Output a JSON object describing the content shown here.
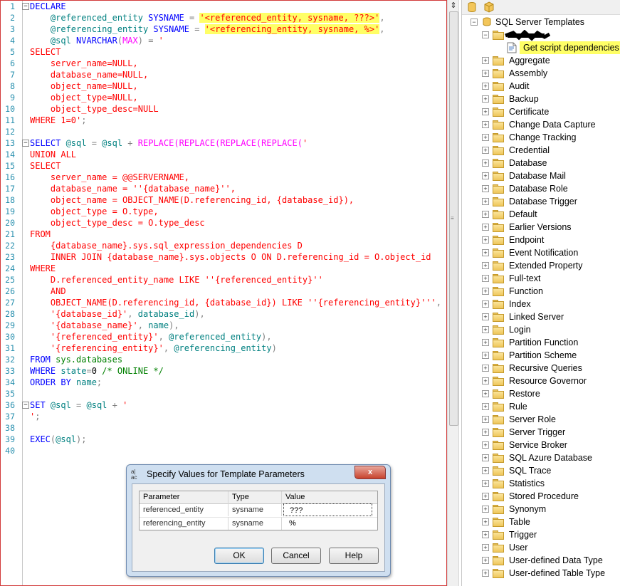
{
  "editor": {
    "lines": [
      {
        "num": "1",
        "fold": "−",
        "segs": [
          {
            "t": "DECLARE",
            "c": "k"
          }
        ]
      },
      {
        "num": "2",
        "segs": [
          {
            "t": "    @referenced_entity ",
            "c": "c"
          },
          {
            "t": "SYSNAME",
            "c": "k"
          },
          {
            "t": " = ",
            "c": "g"
          },
          {
            "t": "'<referenced_entity, sysname, ???>'",
            "c": "r",
            "hl": true
          },
          {
            "t": ",",
            "c": "g"
          }
        ]
      },
      {
        "num": "3",
        "segs": [
          {
            "t": "    @referencing_entity ",
            "c": "c"
          },
          {
            "t": "SYSNAME",
            "c": "k"
          },
          {
            "t": " = ",
            "c": "g"
          },
          {
            "t": "'<referencing_entity, sysname, %>'",
            "c": "r",
            "hl": true
          },
          {
            "t": ",",
            "c": "g"
          }
        ]
      },
      {
        "num": "4",
        "segs": [
          {
            "t": "    @sql ",
            "c": "c"
          },
          {
            "t": "NVARCHAR",
            "c": "k"
          },
          {
            "t": "(",
            "c": "g"
          },
          {
            "t": "MAX",
            "c": "m"
          },
          {
            "t": ") = ",
            "c": "g"
          },
          {
            "t": "'",
            "c": "r"
          }
        ]
      },
      {
        "num": "5",
        "segs": [
          {
            "t": "SELECT",
            "c": "r"
          }
        ]
      },
      {
        "num": "6",
        "segs": [
          {
            "t": "    server_name=NULL,",
            "c": "r"
          }
        ]
      },
      {
        "num": "7",
        "segs": [
          {
            "t": "    database_name=NULL,",
            "c": "r"
          }
        ]
      },
      {
        "num": "8",
        "segs": [
          {
            "t": "    object_name=NULL,",
            "c": "r"
          }
        ]
      },
      {
        "num": "9",
        "segs": [
          {
            "t": "    object_type=NULL,",
            "c": "r"
          }
        ]
      },
      {
        "num": "10",
        "segs": [
          {
            "t": "    object_type_desc=NULL",
            "c": "r"
          }
        ]
      },
      {
        "num": "11",
        "segs": [
          {
            "t": "WHERE 1=0'",
            "c": "r"
          },
          {
            "t": ";",
            "c": "g"
          }
        ]
      },
      {
        "num": "12",
        "segs": []
      },
      {
        "num": "13",
        "fold": "−",
        "segs": [
          {
            "t": "SELECT",
            "c": "k"
          },
          {
            "t": " @sql ",
            "c": "c"
          },
          {
            "t": "= ",
            "c": "g"
          },
          {
            "t": "@sql",
            "c": "c"
          },
          {
            "t": " + ",
            "c": "g"
          },
          {
            "t": "REPLACE(REPLACE(REPLACE(REPLACE(",
            "c": "m"
          },
          {
            "t": "'",
            "c": "r"
          }
        ]
      },
      {
        "num": "14",
        "segs": [
          {
            "t": "UNION ALL",
            "c": "r"
          }
        ]
      },
      {
        "num": "15",
        "segs": [
          {
            "t": "SELECT",
            "c": "r"
          }
        ]
      },
      {
        "num": "16",
        "segs": [
          {
            "t": "    server_name = @@SERVERNAME,",
            "c": "r"
          }
        ]
      },
      {
        "num": "17",
        "segs": [
          {
            "t": "    database_name = ''{database_name}'',",
            "c": "r"
          }
        ]
      },
      {
        "num": "18",
        "segs": [
          {
            "t": "    object_name = OBJECT_NAME(D.referencing_id, {database_id}),",
            "c": "r"
          }
        ]
      },
      {
        "num": "19",
        "segs": [
          {
            "t": "    object_type = O.type,",
            "c": "r"
          }
        ]
      },
      {
        "num": "20",
        "segs": [
          {
            "t": "    object_type_desc = O.type_desc",
            "c": "r"
          }
        ]
      },
      {
        "num": "21",
        "segs": [
          {
            "t": "FROM",
            "c": "r"
          }
        ]
      },
      {
        "num": "22",
        "segs": [
          {
            "t": "    {database_name}.sys.sql_expression_dependencies D",
            "c": "r"
          }
        ]
      },
      {
        "num": "23",
        "segs": [
          {
            "t": "    INNER JOIN {database_name}.sys.objects O ON D.referencing_id = O.object_id",
            "c": "r"
          }
        ]
      },
      {
        "num": "24",
        "segs": [
          {
            "t": "WHERE",
            "c": "r"
          }
        ]
      },
      {
        "num": "25",
        "segs": [
          {
            "t": "    D.referenced_entity_name LIKE ''{referenced_entity}''",
            "c": "r"
          }
        ]
      },
      {
        "num": "26",
        "segs": [
          {
            "t": "    AND",
            "c": "r"
          }
        ]
      },
      {
        "num": "27",
        "segs": [
          {
            "t": "    OBJECT_NAME(D.referencing_id, {database_id}) LIKE ''{referencing_entity}'''",
            "c": "r"
          },
          {
            "t": ",",
            "c": "g"
          }
        ]
      },
      {
        "num": "28",
        "segs": [
          {
            "t": "    ",
            "c": "g"
          },
          {
            "t": "'{database_id}'",
            "c": "r"
          },
          {
            "t": ", ",
            "c": "g"
          },
          {
            "t": "database_id",
            "c": "c"
          },
          {
            "t": "),",
            "c": "g"
          }
        ]
      },
      {
        "num": "29",
        "segs": [
          {
            "t": "    ",
            "c": "g"
          },
          {
            "t": "'{database_name}'",
            "c": "r"
          },
          {
            "t": ", ",
            "c": "g"
          },
          {
            "t": "name",
            "c": "c"
          },
          {
            "t": "),",
            "c": "g"
          }
        ]
      },
      {
        "num": "30",
        "segs": [
          {
            "t": "    ",
            "c": "g"
          },
          {
            "t": "'{referenced_entity}'",
            "c": "r"
          },
          {
            "t": ", ",
            "c": "g"
          },
          {
            "t": "@referenced_entity",
            "c": "c"
          },
          {
            "t": "),",
            "c": "g"
          }
        ]
      },
      {
        "num": "31",
        "segs": [
          {
            "t": "    ",
            "c": "g"
          },
          {
            "t": "'{referencing_entity}'",
            "c": "r"
          },
          {
            "t": ", ",
            "c": "g"
          },
          {
            "t": "@referencing_entity",
            "c": "c"
          },
          {
            "t": ")",
            "c": "g"
          }
        ]
      },
      {
        "num": "32",
        "segs": [
          {
            "t": "FROM",
            "c": "k"
          },
          {
            "t": " sys.databases",
            "c": "gr"
          }
        ]
      },
      {
        "num": "33",
        "segs": [
          {
            "t": "WHERE",
            "c": "k"
          },
          {
            "t": " state",
            "c": "c"
          },
          {
            "t": "=",
            "c": "g"
          },
          {
            "t": "0 ",
            "c": "b"
          },
          {
            "t": "/* ONLINE */",
            "c": "gr"
          }
        ]
      },
      {
        "num": "34",
        "segs": [
          {
            "t": "ORDER BY",
            "c": "k"
          },
          {
            "t": " name",
            "c": "c"
          },
          {
            "t": ";",
            "c": "g"
          }
        ]
      },
      {
        "num": "35",
        "segs": []
      },
      {
        "num": "36",
        "fold": "−",
        "segs": [
          {
            "t": "SET",
            "c": "k"
          },
          {
            "t": " @sql ",
            "c": "c"
          },
          {
            "t": "= ",
            "c": "g"
          },
          {
            "t": "@sql",
            "c": "c"
          },
          {
            "t": " + ",
            "c": "g"
          },
          {
            "t": "'",
            "c": "r"
          }
        ]
      },
      {
        "num": "37",
        "segs": [
          {
            "t": "'",
            "c": "r"
          },
          {
            "t": ";",
            "c": "g"
          }
        ]
      },
      {
        "num": "38",
        "segs": []
      },
      {
        "num": "39",
        "segs": [
          {
            "t": "EXEC",
            "c": "k"
          },
          {
            "t": "(",
            "c": "g"
          },
          {
            "t": "@sql",
            "c": "c"
          },
          {
            "t": ");",
            "c": "g"
          }
        ]
      },
      {
        "num": "40",
        "segs": []
      }
    ]
  },
  "explorer": {
    "root_label": "SQL Server Templates",
    "selected_item": "Get script dependencies",
    "folders": [
      "Aggregate",
      "Assembly",
      "Audit",
      "Backup",
      "Certificate",
      "Change Data Capture",
      "Change Tracking",
      "Credential",
      "Database",
      "Database Mail",
      "Database Role",
      "Database Trigger",
      "Default",
      "Earlier Versions",
      "Endpoint",
      "Event Notification",
      "Extended Property",
      "Full-text",
      "Function",
      "Index",
      "Linked Server",
      "Login",
      "Partition Function",
      "Partition Scheme",
      "Recursive Queries",
      "Resource Governor",
      "Restore",
      "Rule",
      "Server Role",
      "Server Trigger",
      "Service Broker",
      "SQL Azure Database",
      "SQL Trace",
      "Statistics",
      "Stored Procedure",
      "Synonym",
      "Table",
      "Trigger",
      "User",
      "User-defined Data Type",
      "User-defined Table Type"
    ]
  },
  "dialog": {
    "title": "Specify Values for Template Parameters",
    "close_glyph": "x",
    "columns": [
      "Parameter",
      "Type",
      "Value"
    ],
    "rows": [
      {
        "parameter": "referenced_entity",
        "type": "sysname",
        "value": "???"
      },
      {
        "parameter": "referencing_entity",
        "type": "sysname",
        "value": "%"
      }
    ],
    "buttons": {
      "ok": "OK",
      "cancel": "Cancel",
      "help": "Help"
    }
  },
  "colors": {
    "highlight": "#ffff66",
    "keyword": "#0000ff",
    "string": "#ff0000",
    "variable": "#008080"
  }
}
